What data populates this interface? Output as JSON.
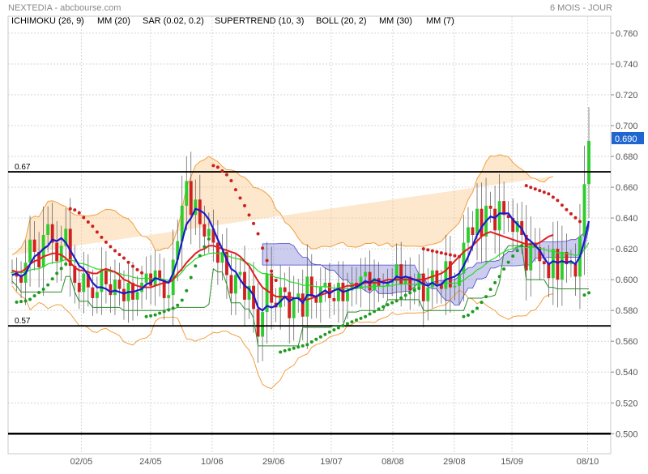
{
  "header": {
    "title": "NEXTEDIA - abcbourse.com",
    "period": "6 MOIS - JOUR"
  },
  "chart_data": {
    "type": "candlestick",
    "legend": [
      {
        "label": "ICHIMOKU (26, 9)",
        "color": "#1a1aff"
      },
      {
        "label": "MM (20)",
        "color": "#e02020"
      },
      {
        "label": "SAR (0.02, 0.2)",
        "color": "#cc2020"
      },
      {
        "label": "SUPERTREND (10, 3)",
        "color": "#2a8a2a"
      },
      {
        "label": "BOLL (20, 2)",
        "color": "#f0a040"
      },
      {
        "label": "MM (30)",
        "color": "#22dd22"
      },
      {
        "label": "MM (7)",
        "color": "#6060e0"
      }
    ],
    "ylim": [
      0.487,
      0.771
    ],
    "y_ticks": [
      "0.760",
      "0.740",
      "0.720",
      "0.700",
      "0.680",
      "0.660",
      "0.640",
      "0.620",
      "0.600",
      "0.580",
      "0.560",
      "0.540",
      "0.520",
      "0.500"
    ],
    "x_ticks": [
      "02/05",
      "24/05",
      "10/06",
      "29/06",
      "19/07",
      "08/08",
      "29/08",
      "15/09",
      "08/10"
    ],
    "last_price": "0.690",
    "h_levels": [
      {
        "label": "0.67",
        "value": 0.67
      },
      {
        "label": "0.57",
        "value": 0.57
      },
      {
        "label": "",
        "value": 0.5
      }
    ],
    "closes": [
      0.605,
      0.602,
      0.598,
      0.611,
      0.626,
      0.618,
      0.608,
      0.629,
      0.636,
      0.624,
      0.612,
      0.622,
      0.633,
      0.609,
      0.598,
      0.592,
      0.604,
      0.595,
      0.588,
      0.592,
      0.606,
      0.597,
      0.59,
      0.6,
      0.594,
      0.586,
      0.598,
      0.587,
      0.592,
      0.598,
      0.604,
      0.596,
      0.606,
      0.6,
      0.588,
      0.59,
      0.613,
      0.625,
      0.648,
      0.664,
      0.642,
      0.652,
      0.636,
      0.628,
      0.633,
      0.624,
      0.611,
      0.618,
      0.603,
      0.591,
      0.603,
      0.605,
      0.587,
      0.596,
      0.581,
      0.563,
      0.579,
      0.604,
      0.585,
      0.582,
      0.595,
      0.592,
      0.575,
      0.588,
      0.591,
      0.576,
      0.602,
      0.589,
      0.585,
      0.595,
      0.598,
      0.588,
      0.586,
      0.598,
      0.586,
      0.593,
      0.598,
      0.594,
      0.602,
      0.605,
      0.593,
      0.601,
      0.596,
      0.596,
      0.598,
      0.599,
      0.61,
      0.597,
      0.602,
      0.593,
      0.595,
      0.604,
      0.586,
      0.595,
      0.606,
      0.597,
      0.594,
      0.612,
      0.595,
      0.596,
      0.604,
      0.624,
      0.634,
      0.629,
      0.646,
      0.628,
      0.648,
      0.646,
      0.632,
      0.651,
      0.642,
      0.64,
      0.631,
      0.638,
      0.629,
      0.606,
      0.624,
      0.621,
      0.612,
      0.61,
      0.601,
      0.62,
      0.6,
      0.618,
      0.61,
      0.611,
      0.602,
      0.628,
      0.662,
      0.69
    ],
    "mm7": [
      0.603,
      0.604,
      0.602,
      0.604,
      0.61,
      0.615,
      0.617,
      0.62,
      0.622,
      0.626,
      0.625,
      0.627,
      0.624,
      0.619,
      0.614,
      0.609,
      0.607,
      0.603,
      0.598,
      0.595,
      0.595,
      0.594,
      0.592,
      0.593,
      0.592,
      0.591,
      0.592,
      0.592,
      0.593,
      0.594,
      0.597,
      0.598,
      0.601,
      0.6,
      0.599,
      0.598,
      0.604,
      0.613,
      0.625,
      0.636,
      0.64,
      0.646,
      0.645,
      0.643,
      0.639,
      0.633,
      0.626,
      0.62,
      0.613,
      0.607,
      0.605,
      0.6,
      0.596,
      0.594,
      0.59,
      0.582,
      0.58,
      0.583,
      0.582,
      0.583,
      0.586,
      0.589,
      0.586,
      0.588,
      0.588,
      0.585,
      0.59,
      0.59,
      0.589,
      0.591,
      0.593,
      0.591,
      0.593,
      0.594,
      0.592,
      0.593,
      0.594,
      0.595,
      0.597,
      0.599,
      0.598,
      0.6,
      0.599,
      0.598,
      0.598,
      0.599,
      0.602,
      0.601,
      0.602,
      0.601,
      0.6,
      0.599,
      0.597,
      0.596,
      0.598,
      0.596,
      0.597,
      0.6,
      0.601,
      0.602,
      0.604,
      0.609,
      0.615,
      0.622,
      0.629,
      0.634,
      0.638,
      0.641,
      0.64,
      0.643,
      0.643,
      0.643,
      0.639,
      0.636,
      0.633,
      0.627,
      0.625,
      0.622,
      0.619,
      0.614,
      0.61,
      0.612,
      0.611,
      0.612,
      0.611,
      0.612,
      0.61,
      0.615,
      0.625,
      0.638
    ],
    "mm20": [
      0.606,
      0.605,
      0.605,
      0.607,
      0.61,
      0.612,
      0.613,
      0.615,
      0.616,
      0.617,
      0.617,
      0.616,
      0.614,
      0.611,
      0.608,
      0.606,
      0.606,
      0.605,
      0.604,
      0.604,
      0.606,
      0.607,
      0.606,
      0.605,
      0.603,
      0.6,
      0.599,
      0.597,
      0.596,
      0.595,
      0.595,
      0.595,
      0.596,
      0.597,
      0.598,
      0.598,
      0.6,
      0.604,
      0.607,
      0.611,
      0.614,
      0.617,
      0.619,
      0.62,
      0.622,
      0.622,
      0.621,
      0.62,
      0.619,
      0.618,
      0.617,
      0.615,
      0.612,
      0.609,
      0.604,
      0.599,
      0.595,
      0.593,
      0.591,
      0.589,
      0.589,
      0.589,
      0.589,
      0.588,
      0.588,
      0.587,
      0.587,
      0.588,
      0.589,
      0.59,
      0.591,
      0.592,
      0.593,
      0.594,
      0.595,
      0.596,
      0.596,
      0.597,
      0.597,
      0.598,
      0.598,
      0.598,
      0.598,
      0.599,
      0.6,
      0.6,
      0.6,
      0.6,
      0.6,
      0.6,
      0.6,
      0.6,
      0.6,
      0.601,
      0.602,
      0.603,
      0.604,
      0.606,
      0.609,
      0.612,
      0.615,
      0.618,
      0.62,
      0.622,
      0.625,
      0.628,
      0.63,
      0.631,
      0.63,
      0.629,
      0.628,
      0.627,
      0.626,
      0.625,
      0.624,
      0.623,
      0.623,
      0.623,
      0.624,
      0.626,
      0.628,
      0.629
    ]
  }
}
